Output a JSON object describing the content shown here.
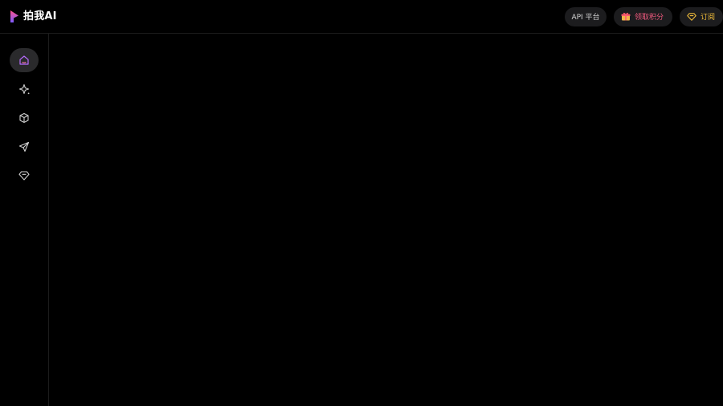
{
  "brand": {
    "name": "拍我AI",
    "logo_icon": "brand-logo-icon",
    "colors": {
      "logo_top": "#ff4f8b",
      "logo_bottom": "#7c5cff"
    }
  },
  "header": {
    "api_label": "API 平台",
    "points_label": "领取积分",
    "points_icon": "gift-icon",
    "points_color": "#f25a7f",
    "subscribe_label": "订阅",
    "subscribe_icon": "diamond-icon",
    "subscribe_color": "#f0bc3a"
  },
  "sidebar": {
    "items": [
      {
        "icon": "home-icon",
        "active": true,
        "active_color": "#b86cff"
      },
      {
        "icon": "sparkle-icon",
        "active": false
      },
      {
        "icon": "cube-icon",
        "active": false
      },
      {
        "icon": "send-icon",
        "active": false
      },
      {
        "icon": "diamond-icon",
        "active": false
      }
    ]
  }
}
